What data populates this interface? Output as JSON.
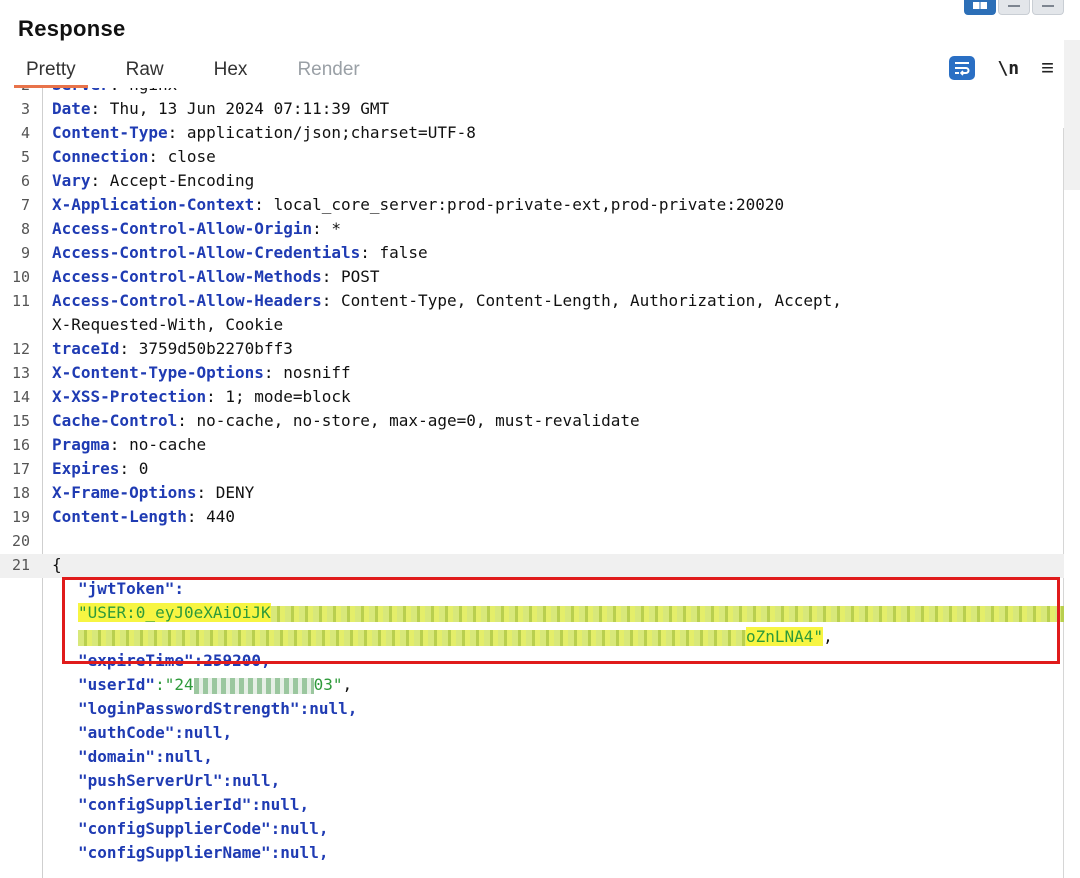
{
  "panel": {
    "title": "Response"
  },
  "tabs": [
    "Pretty",
    "Raw",
    "Hex",
    "Render"
  ],
  "toolbar": {
    "newline_label": "\\n"
  },
  "icons": {
    "wrap": "word-wrap-icon",
    "menu": "hamburger-menu-icon",
    "layout": "layout-toggle-icon"
  },
  "colors": {
    "accent": "#e8734a",
    "header_key": "#1f3bb3",
    "string": "#2e9a3a",
    "highlight": "#f7f542",
    "box": "#e01b1b"
  },
  "headers": [
    {
      "num": "2",
      "key": "Server",
      "value": " nginx"
    },
    {
      "num": "3",
      "key": "Date",
      "value": " Thu, 13 Jun 2024 07:11:39 GMT"
    },
    {
      "num": "4",
      "key": "Content-Type",
      "value": " application/json;charset=UTF-8"
    },
    {
      "num": "5",
      "key": "Connection",
      "value": " close"
    },
    {
      "num": "6",
      "key": "Vary",
      "value": " Accept-Encoding"
    },
    {
      "num": "7",
      "key": "X-Application-Context",
      "value": " local_core_server:prod-private-ext,prod-private:20020"
    },
    {
      "num": "8",
      "key": "Access-Control-Allow-Origin",
      "value": " *"
    },
    {
      "num": "9",
      "key": "Access-Control-Allow-Credentials",
      "value": " false"
    },
    {
      "num": "10",
      "key": "Access-Control-Allow-Methods",
      "value": " POST"
    },
    {
      "num": "11",
      "key": "Access-Control-Allow-Headers",
      "value": " Content-Type, Content-Length, Authorization, Accept,"
    },
    {
      "num": "",
      "key": "",
      "value": "X-Requested-With, Cookie"
    },
    {
      "num": "12",
      "key": "traceId",
      "value": " 3759d50b2270bff3"
    },
    {
      "num": "13",
      "key": "X-Content-Type-Options",
      "value": " nosniff"
    },
    {
      "num": "14",
      "key": "X-XSS-Protection",
      "value": " 1; mode=block"
    },
    {
      "num": "15",
      "key": "Cache-Control",
      "value": " no-cache, no-store, max-age=0, must-revalidate"
    },
    {
      "num": "16",
      "key": "Pragma",
      "value": " no-cache"
    },
    {
      "num": "17",
      "key": "Expires",
      "value": " 0"
    },
    {
      "num": "18",
      "key": "X-Frame-Options",
      "value": " DENY"
    },
    {
      "num": "19",
      "key": "Content-Length",
      "value": " 440"
    }
  ],
  "blank_line_num": "20",
  "body_line_num": "21",
  "body_open": "{",
  "json_body": {
    "jwt_key": "\"jwtToken\":",
    "jwt_value_start": "\"USER:0_eyJ0eXAiOiJK",
    "jwt_value_end": "oZnLNA4\"",
    "jwt_value_end_comma": ",",
    "expire_key": "\"expireTime\"",
    "expire_value": ":259200,",
    "userid_key": "\"userId\"",
    "userid_value_start": ":\"24",
    "userid_value_end": "03\"",
    "userid_comma": ",",
    "fields": [
      {
        "key": "\"loginPasswordStrength\"",
        "value": ":null,"
      },
      {
        "key": "\"authCode\"",
        "value": ":null,"
      },
      {
        "key": "\"domain\"",
        "value": ":null,"
      },
      {
        "key": "\"pushServerUrl\"",
        "value": ":null,"
      },
      {
        "key": "\"configSupplierId\"",
        "value": ":null,"
      },
      {
        "key": "\"configSupplierCode\"",
        "value": ":null,"
      },
      {
        "key": "\"configSupplierName\"",
        "value": ":null,"
      }
    ]
  }
}
